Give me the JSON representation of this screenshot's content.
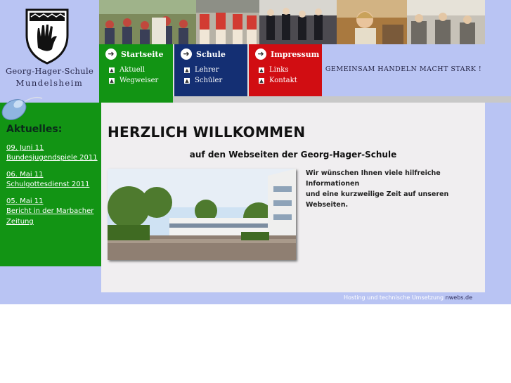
{
  "header": {
    "school_name": "Georg-Hager-Schule",
    "school_town": "Mundelsheim",
    "slogan": "Gemeinsam handeln macht stark !"
  },
  "nav": [
    {
      "label": "Startseite",
      "color": "#129414",
      "sub": [
        "Aktuell",
        "Wegweiser"
      ]
    },
    {
      "label": "Schule",
      "color": "#142f73",
      "sub": [
        "Lehrer",
        "Schüler"
      ]
    },
    {
      "label": "Impressum",
      "color": "#d10d12",
      "sub": [
        "Links",
        "Kontakt"
      ]
    }
  ],
  "sidebar": {
    "title": "Aktuelles:",
    "news": [
      {
        "date": "09. Juni 11",
        "text": "Bundesjugendspiele 2011"
      },
      {
        "date": "06. Mai 11",
        "text": "Schulgottesdienst 2011"
      },
      {
        "date": "05. Mai 11",
        "text": "Bericht in der Marbacher",
        "text2": "Zeitung"
      }
    ]
  },
  "main": {
    "title": "HERZLICH WILLKOMMEN",
    "subtitle": "auf den Webseiten der Georg-Hager-Schule",
    "intro_line1": "Wir wünschen Ihnen viele hilfreiche Informationen",
    "intro_line2": "und eine kurzweilige Zeit auf unseren Webseiten."
  },
  "footer": {
    "text": "Hosting und technische Umsetzung",
    "link": "nwebs.de"
  },
  "colors": {
    "accent_blue": "#b9c4f3",
    "green": "#129414",
    "navy": "#142f73",
    "red": "#d10d12"
  },
  "icons": [
    "crest-logo",
    "arrow-circle-icon",
    "checkbox-arrow-icon",
    "computer-mouse-icon"
  ]
}
